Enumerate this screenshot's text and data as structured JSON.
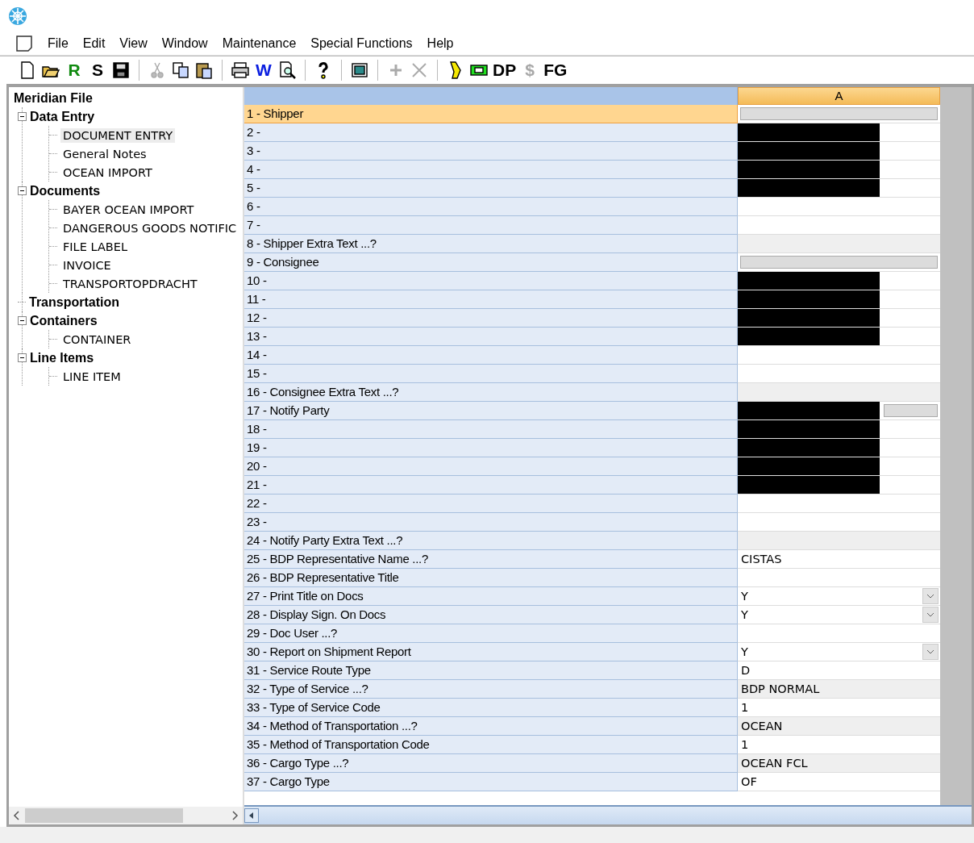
{
  "menu": [
    {
      "label": "File"
    },
    {
      "label": "Edit"
    },
    {
      "label": "View"
    },
    {
      "label": "Window"
    },
    {
      "label": "Maintenance"
    },
    {
      "label": "Special Functions"
    },
    {
      "label": "Help"
    }
  ],
  "toolbar": [
    {
      "kind": "icon",
      "disabled": false
    },
    {
      "kind": "icon",
      "disabled": false
    },
    {
      "kind": "glyph",
      "label": "R",
      "color": "#108a10"
    },
    {
      "kind": "glyph",
      "label": "S",
      "color": "#000000"
    },
    {
      "kind": "icon",
      "disabled": false
    },
    {
      "kind": "separator"
    },
    {
      "kind": "icon",
      "disabled": true
    },
    {
      "kind": "icon",
      "disabled": false
    },
    {
      "kind": "icon",
      "disabled": false
    },
    {
      "kind": "separator"
    },
    {
      "kind": "icon",
      "disabled": false
    },
    {
      "kind": "glyph",
      "label": "W",
      "color": "#0a1ee0"
    },
    {
      "kind": "icon",
      "disabled": false
    },
    {
      "kind": "separator"
    },
    {
      "kind": "icon",
      "disabled": false
    },
    {
      "kind": "separator"
    },
    {
      "kind": "icon",
      "disabled": false
    },
    {
      "kind": "separator"
    },
    {
      "kind": "icon",
      "disabled": true
    },
    {
      "kind": "icon",
      "disabled": true
    },
    {
      "kind": "separator"
    },
    {
      "kind": "icon",
      "disabled": false
    },
    {
      "kind": "icon",
      "disabled": false
    },
    {
      "kind": "glyph",
      "label": "DP",
      "color": "#000000"
    },
    {
      "kind": "glyph",
      "label": "$",
      "color": "#a8a8a8"
    },
    {
      "kind": "glyph",
      "label": "FG",
      "color": "#000000"
    }
  ],
  "tree": {
    "label": "Meridian File",
    "children": [
      {
        "label": "Data Entry",
        "expanded": true,
        "children": [
          {
            "label": "DOCUMENT ENTRY",
            "selected": true
          },
          {
            "label": "General Notes",
            "selected": false
          },
          {
            "label": "OCEAN IMPORT",
            "selected": false
          }
        ]
      },
      {
        "label": "Documents",
        "expanded": true,
        "children": [
          {
            "label": "BAYER OCEAN IMPORT",
            "selected": false
          },
          {
            "label": "DANGEROUS GOODS NOTIFIC",
            "selected": false
          },
          {
            "label": "FILE LABEL",
            "selected": false
          },
          {
            "label": "INVOICE",
            "selected": false
          },
          {
            "label": "TRANSPORTOPDRACHT",
            "selected": false
          }
        ]
      },
      {
        "label": "Transportation"
      },
      {
        "label": "Containers",
        "expanded": true,
        "children": [
          {
            "label": "CONTAINER",
            "selected": false
          }
        ]
      },
      {
        "label": "Line Items",
        "expanded": true,
        "children": [
          {
            "label": "LINE ITEM",
            "selected": false
          }
        ]
      }
    ]
  },
  "grid": {
    "columns": [
      "A"
    ],
    "rows": [
      {
        "label": "1 - Shipper",
        "kind": "button",
        "selected": true,
        "redacted": false
      },
      {
        "label": "2 -",
        "kind": "text",
        "selected": false,
        "redacted": true
      },
      {
        "label": "3 -",
        "kind": "text",
        "selected": false,
        "redacted": true
      },
      {
        "label": "4 -",
        "kind": "text",
        "selected": false,
        "redacted": true
      },
      {
        "label": "5 -",
        "kind": "text",
        "selected": false,
        "redacted": true
      },
      {
        "label": "6 -",
        "kind": "text",
        "selected": false,
        "redacted": false
      },
      {
        "label": "7 -",
        "kind": "text",
        "selected": false,
        "redacted": false
      },
      {
        "label": "8 - Shipper Extra Text ...?",
        "kind": "readonly",
        "selected": false,
        "redacted": false
      },
      {
        "label": "9 - Consignee",
        "kind": "button",
        "selected": false,
        "redacted": false
      },
      {
        "label": "10 -",
        "kind": "text",
        "selected": false,
        "redacted": true
      },
      {
        "label": "11 -",
        "kind": "text",
        "selected": false,
        "redacted": true
      },
      {
        "label": "12 -",
        "kind": "text",
        "selected": false,
        "redacted": true
      },
      {
        "label": "13 -",
        "kind": "text",
        "selected": false,
        "redacted": true
      },
      {
        "label": "14 -",
        "kind": "text",
        "selected": false,
        "redacted": false
      },
      {
        "label": "15 -",
        "kind": "text",
        "selected": false,
        "redacted": false
      },
      {
        "label": "16 - Consignee Extra Text ...?",
        "kind": "readonly",
        "selected": false,
        "redacted": false
      },
      {
        "label": "17 - Notify Party",
        "kind": "button",
        "selected": false,
        "redacted": true
      },
      {
        "label": "18 -",
        "kind": "text",
        "selected": false,
        "redacted": true
      },
      {
        "label": "19 -",
        "kind": "text",
        "selected": false,
        "redacted": true
      },
      {
        "label": "20 -",
        "kind": "text",
        "selected": false,
        "redacted": true
      },
      {
        "label": "21 -",
        "kind": "text",
        "selected": false,
        "redacted": true
      },
      {
        "label": "22 -",
        "kind": "text",
        "selected": false,
        "redacted": false
      },
      {
        "label": "23 -",
        "kind": "text",
        "selected": false,
        "redacted": false
      },
      {
        "label": "24 - Notify Party Extra Text ...?",
        "kind": "readonly",
        "selected": false,
        "redacted": false
      },
      {
        "label": "25 - BDP Representative Name ...?",
        "kind": "text",
        "value": "CISTAS",
        "selected": false,
        "redacted": false
      },
      {
        "label": "26 - BDP Representative Title",
        "kind": "text",
        "selected": false,
        "redacted": false
      },
      {
        "label": "27 - Print Title on Docs",
        "kind": "dropdown",
        "value": "Y",
        "selected": false,
        "redacted": false
      },
      {
        "label": "28 - Display Sign. On Docs",
        "kind": "dropdown",
        "value": "Y",
        "selected": false,
        "redacted": false
      },
      {
        "label": "29 - Doc User ...?",
        "kind": "text",
        "selected": false,
        "redacted": false
      },
      {
        "label": "30 - Report on Shipment Report",
        "kind": "dropdown",
        "value": "Y",
        "selected": false,
        "redacted": false
      },
      {
        "label": "31 - Service Route Type",
        "kind": "text",
        "value": "D",
        "selected": false,
        "redacted": false
      },
      {
        "label": "32 - Type of Service ...?",
        "kind": "readonly",
        "value": "BDP NORMAL",
        "selected": false,
        "redacted": false
      },
      {
        "label": "33 - Type of Service Code",
        "kind": "text",
        "value": "1",
        "selected": false,
        "redacted": false
      },
      {
        "label": "34 - Method of Transportation ...?",
        "kind": "readonly",
        "value": "OCEAN",
        "selected": false,
        "redacted": false
      },
      {
        "label": "35 - Method of Transportation Code",
        "kind": "text",
        "value": "1",
        "selected": false,
        "redacted": false
      },
      {
        "label": "36 - Cargo Type ...?",
        "kind": "readonly",
        "value": "OCEAN FCL",
        "selected": false,
        "redacted": false
      },
      {
        "label": "37 - Cargo Type",
        "kind": "text",
        "value": "OF",
        "selected": false,
        "redacted": false
      }
    ]
  }
}
